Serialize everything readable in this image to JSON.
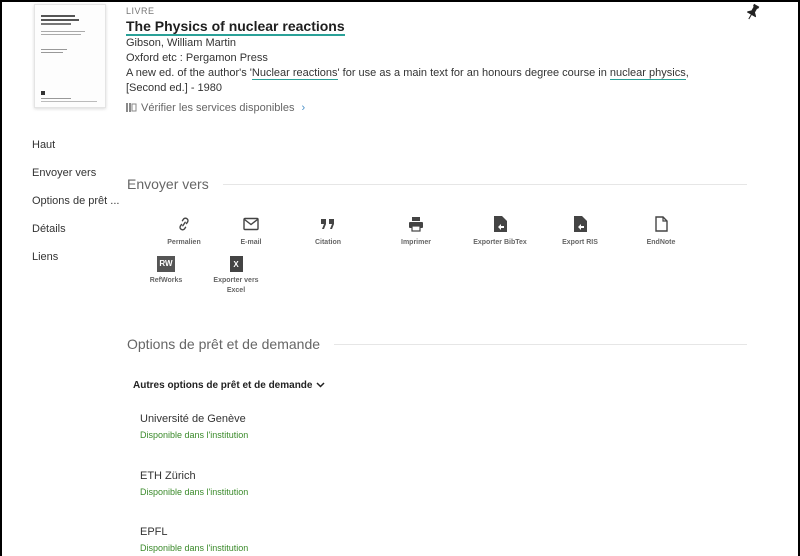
{
  "record": {
    "type": "LIVRE",
    "title": "The Physics of nuclear reactions",
    "author": "Gibson, William Martin",
    "publisher": "Oxford etc : Pergamon Press",
    "desc_pre": "A new ed. of the author's '",
    "desc_link1": "Nuclear reactions",
    "desc_mid": "' for use as a main text for an honours degree course in ",
    "desc_link2": "nuclear physics",
    "desc_post": ",",
    "edition": "[Second ed.] - 1980",
    "services_label": "Vérifier les services disponibles",
    "services_chevron": "›"
  },
  "sidebar": {
    "items": [
      {
        "label": "Haut"
      },
      {
        "label": "Envoyer vers"
      },
      {
        "label": "Options de prêt ..."
      },
      {
        "label": "Détails"
      },
      {
        "label": "Liens"
      }
    ]
  },
  "send_to": {
    "heading": "Envoyer vers",
    "actions": [
      {
        "label": "Permalien",
        "icon": "link-icon"
      },
      {
        "label": "E-mail",
        "icon": "mail-icon"
      },
      {
        "label": "Citation",
        "icon": "quote-icon"
      },
      {
        "label": "Imprimer",
        "icon": "printer-icon"
      },
      {
        "label": "Exporter BibTex",
        "icon": "file-export-icon"
      },
      {
        "label": "Export RIS",
        "icon": "file-export-icon"
      },
      {
        "label": "EndNote",
        "icon": "document-icon"
      },
      {
        "label": "RefWorks",
        "icon": "refworks-icon",
        "badge": "RW"
      },
      {
        "label": "Exporter vers Excel",
        "icon": "excel-icon",
        "badge": "X"
      }
    ]
  },
  "loan": {
    "heading": "Options de prêt et de demande",
    "other_options": "Autres options de prêt et de demande",
    "locations": [
      {
        "name": "Université de Genève",
        "status": "Disponible dans l'institution"
      },
      {
        "name": "ETH Zürich",
        "status": "Disponible dans l'institution"
      },
      {
        "name": "EPFL",
        "status": "Disponible dans l'institution"
      }
    ]
  },
  "colors": {
    "accent_underline": "#2aa198",
    "available_green": "#3a8a2a",
    "services_chevron": "#4a90c8"
  }
}
